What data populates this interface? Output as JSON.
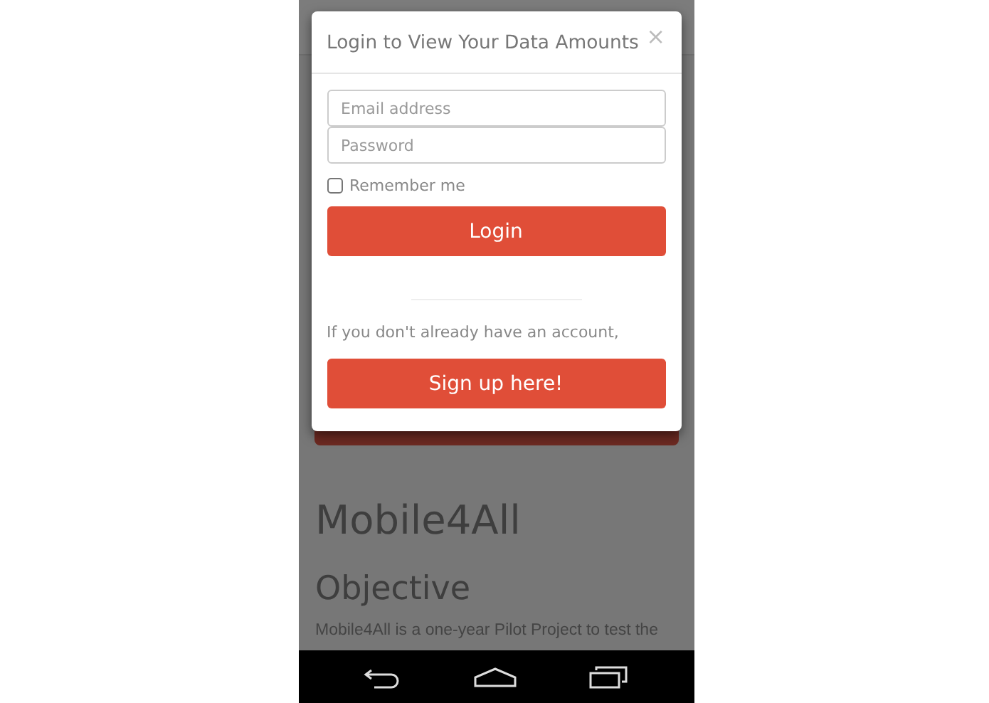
{
  "modal": {
    "title": "Login to View Your Data Amounts",
    "close": "×",
    "fields": [
      {
        "placeholder": "Email address"
      },
      {
        "placeholder": "Password"
      }
    ],
    "remember": {
      "label": "Remember me",
      "checked": false
    },
    "login_button": "Login",
    "signup_prompt": "If you don't already have an account,",
    "signup_button": "Sign up here!"
  },
  "page": {
    "heading": "Mobile4All",
    "section_heading": "Objective",
    "paragraph": "Mobile4All is a one-year Pilot Project to test the"
  }
}
